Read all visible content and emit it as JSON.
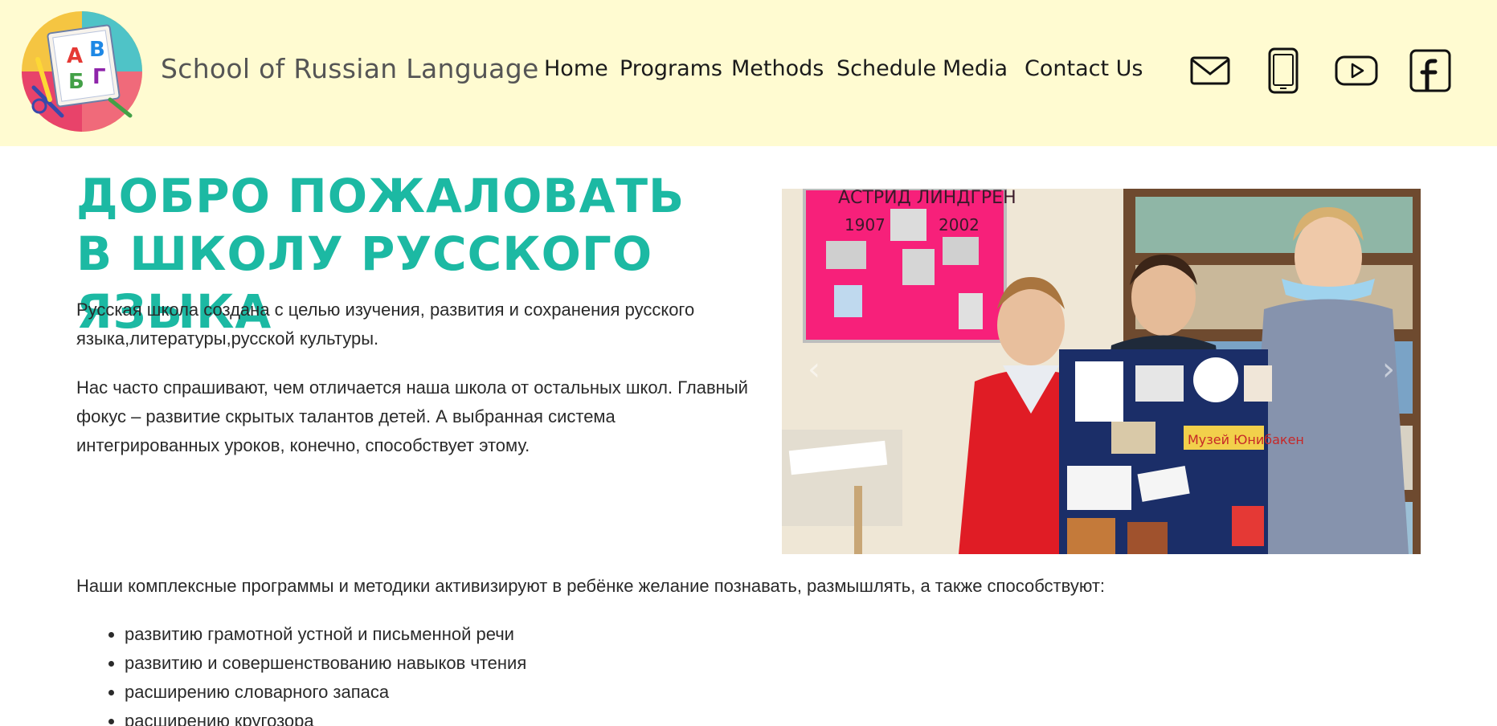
{
  "header": {
    "site_title": "School of Russian Language",
    "logo_letters": [
      "А",
      "В",
      "Б",
      "Г"
    ],
    "nav": [
      {
        "label": "Home"
      },
      {
        "label": "Programs"
      },
      {
        "label": "Methods"
      },
      {
        "label": "Schedule"
      },
      {
        "label": "Media"
      },
      {
        "label": "Contact Us"
      }
    ],
    "social_icons": [
      "mail-icon",
      "phone-icon",
      "youtube-icon",
      "facebook-icon"
    ]
  },
  "main": {
    "welcome_heading": "ДОБРО ПОЖАЛОВАТЬ В ШКОЛУ РУССКОГО ЯЗЫКА",
    "paragraph_1": "Русская школа создана с целью изучения, развития и сохранения русского языка,литературы,русской культуры.",
    "paragraph_2": "Нас часто спрашивают, чем отличается наша школа от остальных школ. Главный фокус – развитие скрытых талантов детей. А выбранная система интегрированных уроков, конечно, способствует этому.",
    "paragraph_3": "Наши комплексные программы и методики активизируют в ребёнке желание познавать, размышлять, а также способствуют:",
    "features": [
      "развитию грамотной устной и письменной речи",
      "развитию и совершенствованию навыков чтения",
      "расширению словарного запаса",
      "расширению кругозора"
    ]
  },
  "carousel": {
    "poster_title": "АСТРИД ЛИНДГРЕН",
    "poster_year_start": "1907",
    "poster_year_end": "2002",
    "board_label": "Музей Юнибакен",
    "prev_glyph": "‹",
    "next_glyph": "›"
  },
  "colors": {
    "header_bg": "#fffbd1",
    "heading": "#1cb9a3",
    "body_text": "#2a2a2a"
  }
}
